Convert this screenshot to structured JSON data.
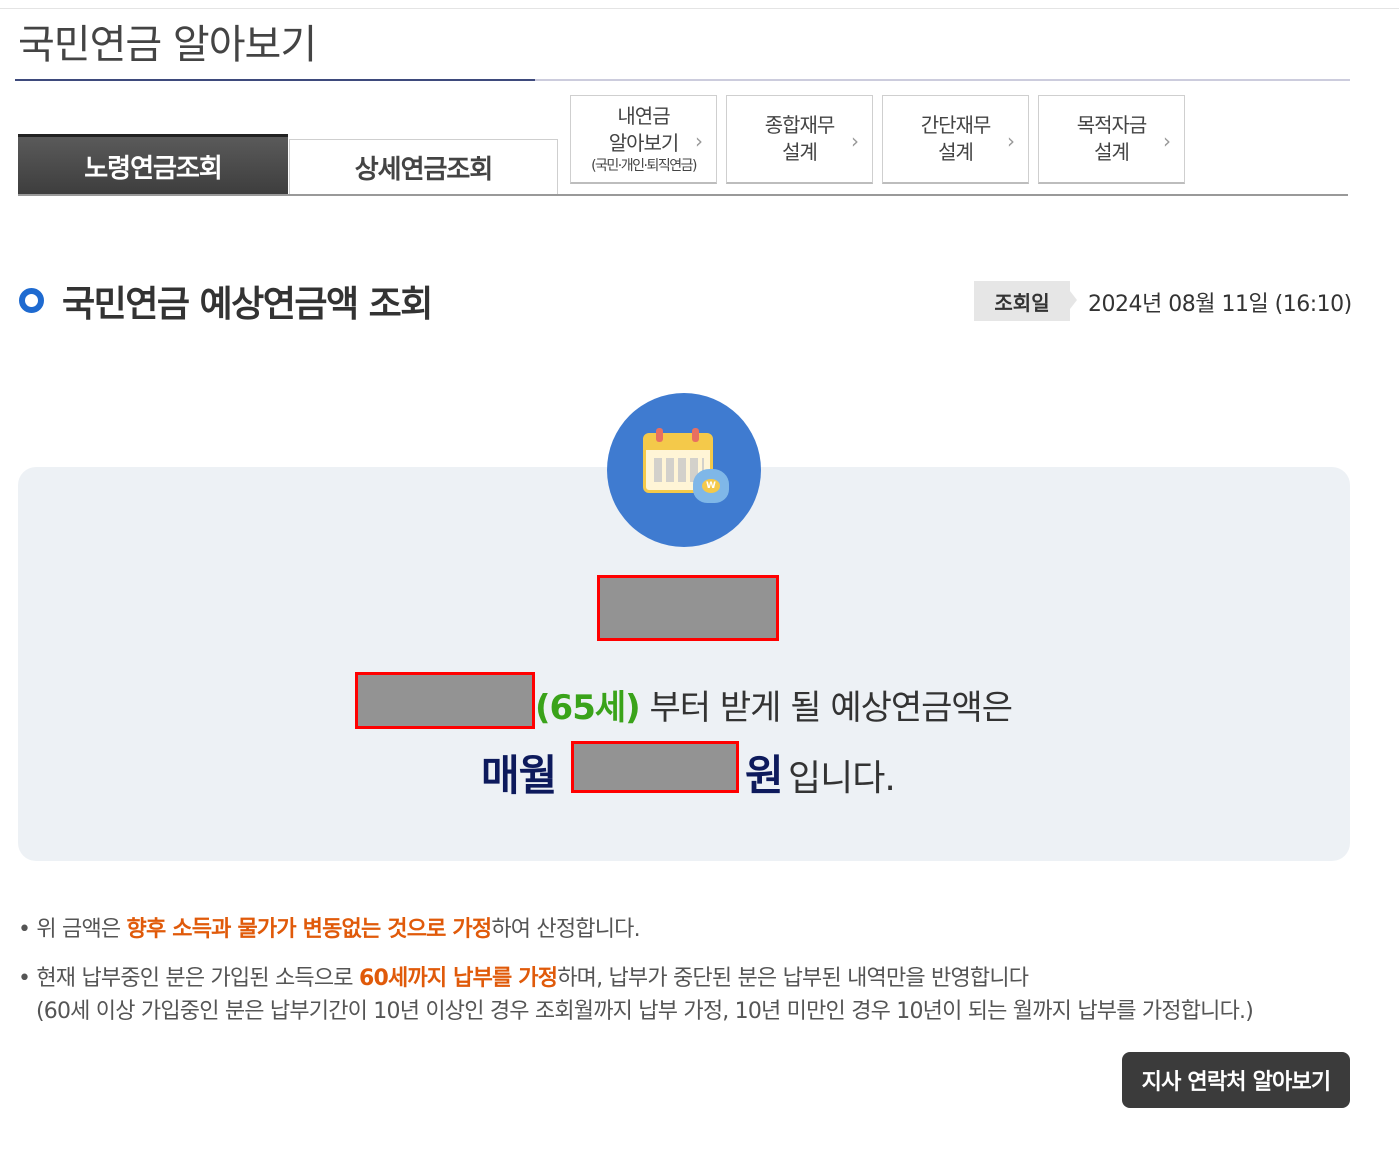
{
  "page": {
    "title": "국민연금 알아보기"
  },
  "tabs": {
    "active": "노령연금조회",
    "inactive": "상세연금조회"
  },
  "sub_tabs": [
    {
      "line1": "내연금",
      "line2": "알아보기",
      "line3": "(국민·개인·퇴직연금)"
    },
    {
      "line1": "종합재무",
      "line2": "설계"
    },
    {
      "line1": "간단재무",
      "line2": "설계"
    },
    {
      "line1": "목적자금",
      "line2": "설계"
    }
  ],
  "section": {
    "title": "국민연금 예상연금액 조회",
    "date_label": "조회일",
    "date_value": "2024년 08월 11일 (16:10)"
  },
  "result": {
    "age": "(65세)",
    "line1_rest": " 부터 받게 될 예상연금액은",
    "monthly": "매월",
    "won": "원",
    "suffix": "입니다."
  },
  "notes": {
    "n1_prefix": "• 위 금액은 ",
    "n1_highlight": "향후 소득과 물가가 변동없는 것으로 가정",
    "n1_suffix": "하여 산정합니다.",
    "n2_prefix": "• 현재 납부중인 분은 가입된 소득으로 ",
    "n2_highlight": "60세까지 납부를 가정",
    "n2_suffix": "하며, 납부가 중단된 분은 납부된 내역만을 반영합니다",
    "n3": "(60세 이상 가입중인 분은 납부기간이 10년 이상인 경우 조회월까지 납부 가정, 10년 미만인 경우 10년이 되는 월까지 납부를 가정합니다.)"
  },
  "contact_button": "지사 연락처 알아보기",
  "colors": {
    "accent": "#1e6ad0",
    "highlight": "#e05a0a",
    "age": "#3aa31a",
    "navy": "#0d1a5c"
  }
}
